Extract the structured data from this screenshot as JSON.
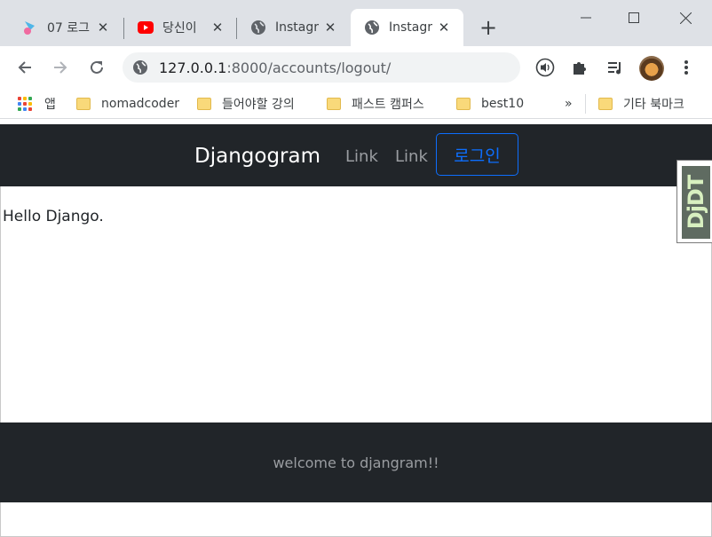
{
  "browser": {
    "tabs": [
      {
        "title": "07 로그",
        "favicon": "site-icon",
        "active": false
      },
      {
        "title": "당신이",
        "favicon": "youtube-icon",
        "active": false
      },
      {
        "title": "Instagr",
        "favicon": "globe-icon",
        "active": false
      },
      {
        "title": "Instagr",
        "favicon": "globe-icon",
        "active": true
      }
    ],
    "close_glyph": "✕",
    "new_tab_glyph": "+",
    "address": {
      "host": "127.0.0.1",
      "path": ":8000/accounts/logout/"
    },
    "window_controls": {
      "minimize": "—",
      "maximize": "☐",
      "close": "✕"
    },
    "bookmarks": {
      "apps_label": "앱",
      "items": [
        "nomadcoder",
        "들어야할 강의",
        "패스트 캠퍼스",
        "best10"
      ],
      "overflow": "»",
      "other_label": "기타 북마크"
    }
  },
  "page": {
    "navbar": {
      "brand": "Djangogram",
      "links": [
        "Link",
        "Link"
      ],
      "login_label": "로그인"
    },
    "body_text": "Hello Django.",
    "footer_text": "welcome to djangram!!",
    "debug_toolbar_label": "DjDT"
  },
  "colors": {
    "navbar_bg": "#212529",
    "login_accent": "#0d6efd",
    "tabstrip_bg": "#dee1e6",
    "youtube_red": "#ff0000"
  }
}
